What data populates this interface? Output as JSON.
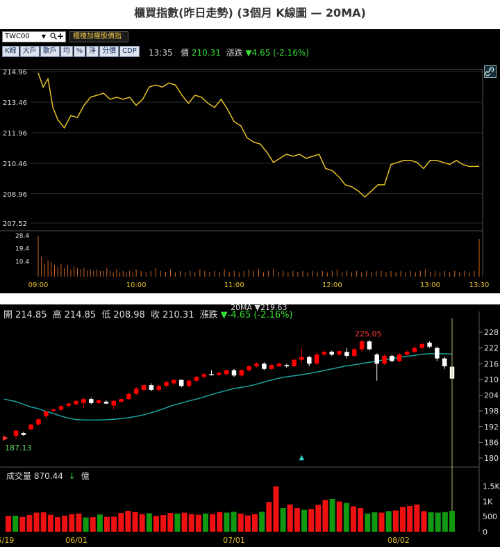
{
  "title": "櫃買指數(昨日走勢) (3個月 K線圖 — 20MA)",
  "intraday": {
    "symbol": "TWC00",
    "index_menu": "櫃檯加權股價指",
    "tabs": [
      "K線",
      "大戶",
      "散戶",
      "均",
      "%",
      "淨",
      "分價",
      "CDP"
    ],
    "time": "13:35",
    "price_label": "價",
    "price": "210.31",
    "change_label": "漲跌",
    "change": "▼4.65 (-2.16%)"
  },
  "daily": {
    "open_label": "開",
    "open": "214.85",
    "high_label": "高",
    "high": "214.85",
    "low_label": "低",
    "low": "208.98",
    "close_label": "收",
    "close": "210.31",
    "change_label": "漲跌",
    "change": "▼-4.65 (-2.16%)",
    "ma_legend": "20MA ▼219.63",
    "volume_label": "成交量",
    "volume": "870.44",
    "volume_arrow": "↓",
    "volume_unit": "億"
  },
  "colors": {
    "up": "#ff0000",
    "down": "#ffffff",
    "up_volume": "#ee1111",
    "down_volume": "#119911",
    "intraday_line": "#e6c229",
    "intraday_volume": "#d2691e",
    "ma": "#1aa3a3"
  },
  "chart_data": [
    {
      "type": "line",
      "name": "intraday",
      "x_ticks": [
        "09:00",
        "10:00",
        "11:00",
        "12:00",
        "13:00",
        "13:30"
      ],
      "y_ticks": [
        "214.96",
        "213.46",
        "211.96",
        "210.46",
        "208.96",
        "207.52"
      ],
      "ylim": [
        207.52,
        214.96
      ],
      "series": [
        {
          "x_minutes": [
            0,
            3,
            6,
            9,
            12,
            16,
            20,
            24,
            28,
            32,
            36,
            40,
            44,
            48,
            52,
            56,
            60,
            64,
            68,
            72,
            76,
            80,
            84,
            88,
            92,
            96,
            100,
            104,
            108,
            112,
            116,
            120,
            124,
            128,
            132,
            136,
            140,
            144,
            148,
            152,
            156,
            160,
            164,
            168,
            172,
            176,
            180,
            184,
            188,
            192,
            196,
            200,
            204,
            208,
            212,
            216,
            220,
            224,
            228,
            232,
            236,
            240,
            244,
            248,
            252,
            256,
            260,
            264,
            270
          ],
          "values": [
            214.9,
            214.2,
            214.6,
            213.2,
            212.6,
            212.2,
            212.8,
            212.7,
            213.3,
            213.7,
            213.8,
            213.9,
            213.6,
            213.7,
            213.6,
            213.7,
            213.3,
            213.6,
            214.2,
            214.3,
            214.2,
            214.4,
            214.3,
            213.8,
            213.4,
            213.8,
            213.7,
            213.4,
            213.2,
            213.6,
            213.1,
            212.5,
            212.3,
            211.7,
            211.5,
            211.4,
            211.0,
            210.5,
            210.7,
            210.9,
            210.8,
            210.9,
            210.7,
            210.8,
            210.9,
            210.2,
            210.1,
            209.8,
            209.4,
            209.3,
            209.1,
            208.8,
            209.1,
            209.4,
            209.4,
            210.4,
            210.5,
            210.6,
            210.6,
            210.5,
            210.2,
            210.6,
            210.6,
            210.5,
            210.4,
            210.6,
            210.4,
            210.3,
            210.31
          ]
        }
      ],
      "volume_ticks": [
        "28.4",
        "19.4",
        "10.4"
      ],
      "volume_ylim": [
        0,
        28.4
      ],
      "volume_x_minutes": [
        0,
        2,
        4,
        6,
        8,
        10,
        12,
        14,
        16,
        18,
        20,
        22,
        24,
        26,
        28,
        30,
        32,
        34,
        36,
        38,
        40,
        42,
        44,
        46,
        48,
        50,
        52,
        54,
        56,
        58,
        60,
        63,
        66,
        69,
        72,
        75,
        78,
        81,
        84,
        87,
        90,
        93,
        96,
        99,
        102,
        105,
        108,
        111,
        114,
        117,
        120,
        123,
        126,
        129,
        132,
        135,
        138,
        141,
        144,
        147,
        150,
        153,
        156,
        159,
        162,
        165,
        168,
        171,
        174,
        177,
        180,
        183,
        186,
        189,
        192,
        195,
        198,
        201,
        204,
        207,
        210,
        213,
        216,
        219,
        222,
        225,
        228,
        231,
        234,
        237,
        240,
        243,
        246,
        249,
        252,
        255,
        258,
        261,
        264,
        267,
        270
      ],
      "volume_values": [
        28,
        14,
        9,
        11,
        10,
        8,
        7,
        9,
        6,
        8,
        5,
        7,
        6,
        5,
        6,
        4,
        5,
        4,
        5,
        4,
        4,
        6,
        4,
        3,
        5,
        3,
        4,
        3,
        4,
        3,
        5,
        4,
        3,
        4,
        6,
        4,
        3,
        5,
        3,
        4,
        3,
        4,
        3,
        5,
        4,
        3,
        4,
        3,
        5,
        3,
        4,
        3,
        4,
        5,
        4,
        5,
        3,
        4,
        5,
        3,
        4,
        3,
        4,
        3,
        4,
        3,
        4,
        3,
        4,
        3,
        4,
        5,
        3,
        4,
        3,
        4,
        3,
        4,
        3,
        4,
        4,
        3,
        4,
        3,
        4,
        3,
        4,
        3,
        4,
        5,
        3,
        4,
        3,
        4,
        3,
        4,
        3,
        4,
        3,
        4,
        26
      ]
    },
    {
      "type": "candlestick",
      "name": "daily",
      "x_ticks": [
        "5/19",
        "06/01",
        "07/01",
        "08/02"
      ],
      "y_ticks": [
        228,
        222,
        216,
        210,
        204,
        198,
        192,
        186,
        180
      ],
      "ylim": [
        180,
        228
      ],
      "annotations": [
        "225.05",
        "187.13"
      ],
      "candles": [
        [
          188.5,
          190.0,
          187.13,
          190.5
        ],
        [
          189.5,
          190.0,
          188.5,
          188.8
        ],
        [
          191.0,
          193.0,
          190.5,
          192.8
        ],
        [
          192.8,
          195.0,
          192.5,
          194.8
        ],
        [
          196.0,
          198.0,
          195.5,
          197.8
        ],
        [
          198.0,
          199.0,
          197.5,
          198.5
        ],
        [
          198.5,
          200.0,
          198.0,
          199.8
        ],
        [
          200.0,
          201.0,
          199.5,
          200.8
        ],
        [
          200.5,
          202.0,
          200.0,
          201.8
        ],
        [
          201.0,
          203.0,
          199.0,
          202.5
        ],
        [
          202.5,
          203.0,
          200.5,
          201.0
        ],
        [
          201.0,
          202.5,
          200.5,
          202.0
        ],
        [
          201.5,
          202.0,
          200.5,
          200.8
        ],
        [
          200.0,
          202.0,
          198.5,
          201.8
        ],
        [
          201.5,
          203.0,
          201.0,
          202.5
        ],
        [
          202.5,
          205.0,
          202.0,
          204.5
        ],
        [
          204.5,
          207.0,
          204.0,
          206.5
        ],
        [
          206.0,
          208.0,
          205.5,
          207.8
        ],
        [
          207.8,
          208.5,
          205.5,
          206.0
        ],
        [
          206.0,
          208.0,
          205.5,
          207.5
        ],
        [
          207.5,
          209.5,
          207.0,
          209.0
        ],
        [
          208.5,
          210.0,
          208.0,
          209.8
        ],
        [
          209.8,
          210.0,
          207.0,
          207.5
        ],
        [
          207.5,
          210.0,
          207.0,
          209.5
        ],
        [
          209.5,
          211.5,
          209.0,
          211.0
        ],
        [
          211.0,
          212.5,
          210.5,
          212.0
        ],
        [
          212.0,
          213.5,
          211.5,
          211.8
        ],
        [
          211.8,
          213.0,
          211.0,
          212.5
        ],
        [
          212.0,
          213.8,
          211.5,
          213.5
        ],
        [
          213.5,
          214.0,
          211.0,
          211.5
        ],
        [
          211.5,
          214.0,
          211.0,
          213.5
        ],
        [
          213.5,
          215.5,
          213.0,
          215.0
        ],
        [
          215.0,
          216.5,
          214.5,
          216.0
        ],
        [
          216.0,
          216.5,
          213.5,
          214.0
        ],
        [
          214.0,
          216.0,
          213.5,
          215.5
        ],
        [
          215.0,
          216.5,
          214.8,
          216.0
        ],
        [
          215.5,
          216.0,
          214.5,
          215.0
        ],
        [
          215.0,
          218.0,
          214.8,
          217.5
        ],
        [
          217.5,
          222.0,
          216.5,
          218.5
        ],
        [
          218.5,
          219.0,
          215.0,
          216.0
        ],
        [
          216.0,
          220.0,
          215.5,
          219.5
        ],
        [
          219.5,
          221.0,
          219.0,
          220.5
        ],
        [
          220.5,
          221.0,
          219.0,
          219.5
        ],
        [
          219.5,
          221.0,
          219.0,
          220.8
        ],
        [
          220.5,
          222.0,
          218.0,
          219.0
        ],
        [
          219.0,
          222.0,
          218.5,
          221.5
        ],
        [
          221.5,
          225.05,
          220.5,
          224.5
        ],
        [
          224.5,
          225.0,
          221.0,
          221.5
        ],
        [
          219.5,
          220.0,
          209.5,
          216.0
        ],
        [
          216.0,
          219.5,
          215.5,
          219.0
        ],
        [
          219.0,
          219.5,
          216.5,
          217.0
        ],
        [
          217.0,
          220.0,
          216.5,
          219.5
        ],
        [
          219.5,
          221.0,
          219.0,
          220.5
        ],
        [
          220.5,
          223.0,
          220.0,
          222.0
        ],
        [
          222.0,
          224.0,
          221.5,
          223.5
        ],
        [
          224.0,
          224.5,
          222.0,
          222.5
        ],
        [
          222.0,
          222.5,
          217.0,
          218.0
        ],
        [
          218.0,
          218.5,
          214.0,
          215.0
        ],
        [
          214.85,
          214.85,
          208.98,
          210.31
        ]
      ],
      "ma20": [
        201.5,
        200.5,
        199.5,
        198.8,
        197.8,
        197.0,
        196.0,
        195.2,
        194.7,
        194.5,
        194.5,
        194.5,
        194.6,
        194.8,
        195.0,
        195.4,
        195.9,
        196.5,
        197.3,
        198.2,
        199.2,
        200.2,
        201.0,
        201.8,
        202.5,
        203.3,
        204.2,
        205.0,
        205.8,
        206.5,
        207.0,
        207.5,
        208.2,
        209.0,
        209.8,
        210.5,
        211.0,
        211.4,
        211.8,
        212.3,
        212.8,
        213.4,
        214.0,
        214.6,
        215.2,
        215.6,
        216.1,
        216.5,
        217.0,
        217.5,
        218.0,
        218.4,
        218.8,
        219.2,
        219.6,
        219.8,
        219.8,
        219.8,
        219.63
      ],
      "volume_ticks": [
        "1.5K",
        "1K",
        "500",
        "0"
      ],
      "volume_ylim": [
        0,
        1700
      ],
      "volume_values": [
        520,
        530,
        490,
        550,
        630,
        640,
        560,
        480,
        530,
        580,
        600,
        470,
        480,
        570,
        490,
        500,
        620,
        690,
        650,
        580,
        610,
        520,
        550,
        620,
        600,
        630,
        580,
        560,
        600,
        580,
        650,
        630,
        660,
        600,
        540,
        580,
        660,
        980,
        1500,
        780,
        900,
        780,
        720,
        750,
        890,
        1050,
        1080,
        1000,
        950,
        840,
        780,
        600,
        640,
        630,
        680,
        700,
        820,
        850,
        900,
        680,
        640,
        630,
        650,
        690
      ]
    }
  ]
}
